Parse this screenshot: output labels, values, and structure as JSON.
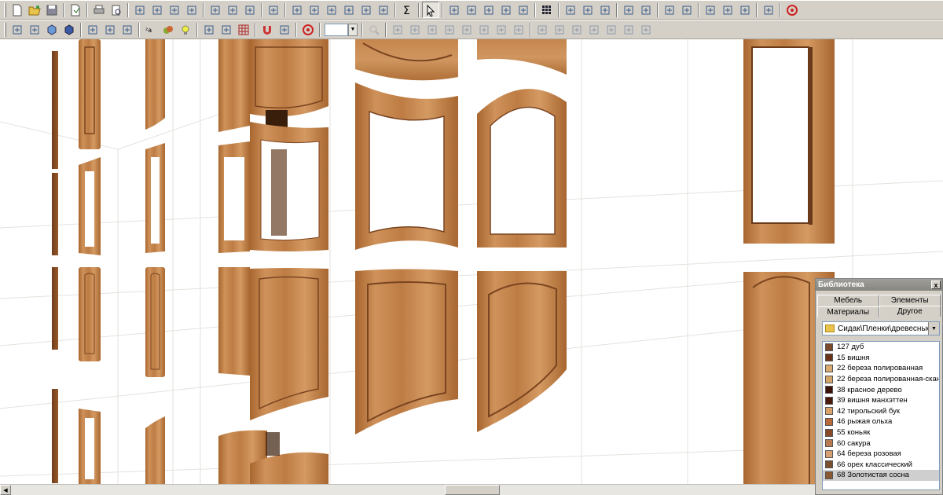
{
  "toolbar1": {
    "groups": [
      [
        "new-file-icon",
        "open-file-icon",
        "save-file-icon"
      ],
      [
        "save-as-icon"
      ],
      [
        "print-icon",
        "print-preview-icon"
      ],
      [
        "cut-icon",
        "copy-icon",
        "paste-icon",
        "delete-icon"
      ],
      [
        "undo-sphere-icon",
        "redo-sphere-icon",
        "object-properties-icon"
      ],
      [
        "model-settings-icon"
      ],
      [
        "panel-icon",
        "panel-cut-icon",
        "panel-edge-icon",
        "panel-hole-icon",
        "panel-door-icon",
        "panel-box-icon"
      ],
      [
        "sum-icon"
      ],
      [
        "pointer-icon"
      ],
      [
        "snap-icon",
        "rect-select-icon",
        "rotate-copy-icon",
        "mirror-icon",
        "undo-arrow-icon"
      ],
      [
        "grid-icon"
      ],
      [
        "move-up-icon",
        "move-pointer-icon",
        "pencil-icon"
      ],
      [
        "bounds-icon",
        "select-all-icon"
      ],
      [
        "arrow-down-icon",
        "arrow-up-icon"
      ],
      [
        "rotate-icon",
        "move-icon",
        "scale-icon"
      ],
      [
        "align-icon"
      ],
      [
        "target-icon"
      ]
    ]
  },
  "toolbar2": {
    "groups": [
      [
        "wireframe-cube-icon",
        "hidden-cube-icon",
        "shaded-cube-icon",
        "solid-cube-icon"
      ],
      [
        "front-view-icon",
        "side-view-icon",
        "top-view-icon"
      ],
      [
        "texture-icon",
        "materials-icon",
        "light-bulb-icon"
      ],
      [
        "rotate-view-icon",
        "dimension-icon",
        "grid-toggle-icon"
      ],
      [
        "magnet-icon",
        "center-icon"
      ],
      [
        "target-icon"
      ]
    ],
    "zoom": {
      "value": ""
    },
    "groups_after": [
      [
        "zoom-icon"
      ],
      [
        "align-left-icon",
        "align-right-icon",
        "align-top-icon",
        "align-bottom-icon",
        "distribute-icon",
        "distribute-v-icon",
        "stack-icon",
        "layout-icon"
      ],
      [
        "align-edge-left-icon",
        "align-edge-right-icon",
        "align-center-icon",
        "align-middle-icon",
        "chart-icon",
        "tree-icon",
        "wizard-icon"
      ]
    ]
  },
  "library": {
    "title": "Библиотека",
    "close_label": "x",
    "tabs_back": [
      "Мебель",
      "Элементы"
    ],
    "tabs_front": [
      "Материалы",
      "Другое"
    ],
    "active_tab": "Материалы",
    "path": "Сидак\\Пленки\\древесные",
    "materials": [
      {
        "name": "127 дуб",
        "color": "#7a4a2a"
      },
      {
        "name": "15 вишня",
        "color": "#6a3318"
      },
      {
        "name": "22 береза полированная",
        "color": "#d8aa70"
      },
      {
        "name": "22 береза полированная-скан",
        "color": "#d4a468"
      },
      {
        "name": "38 красное дерево",
        "color": "#3a1208"
      },
      {
        "name": "39 вишня манхэттен",
        "color": "#4a1a0c"
      },
      {
        "name": "42 тирольский бук",
        "color": "#d9a36a"
      },
      {
        "name": "46 рыжая ольха",
        "color": "#b86a38"
      },
      {
        "name": "55 коньяк",
        "color": "#8a4a28"
      },
      {
        "name": "60 сакура",
        "color": "#b87a50"
      },
      {
        "name": "64 береза розовая",
        "color": "#d8a070"
      },
      {
        "name": "66 орех классический",
        "color": "#7a5030"
      },
      {
        "name": "68 Золотистая сосна",
        "color": "#8a5830"
      }
    ],
    "selected": "68 Золотистая сосна"
  },
  "viewport": {
    "wood_light": "#c98a52",
    "wood_mid": "#b5743e",
    "wood_dark": "#7a4420"
  }
}
